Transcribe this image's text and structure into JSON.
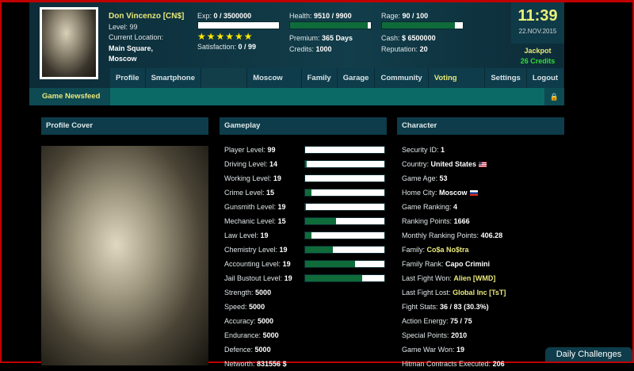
{
  "player": {
    "name": "Don Vincenzo [CN$]",
    "level_label": "Level:",
    "level": "99",
    "location_label": "Current Location:",
    "location1": "Main Square,",
    "location2": "Moscow"
  },
  "stats": {
    "exp_label": "Exp:",
    "exp": "0 / 3500000",
    "exp_fill": 0,
    "stars": "★★★★★★",
    "satisfaction_label": "Satisfaction:",
    "satisfaction": "0 / 99",
    "health_label": "Health:",
    "health": "9510 / 9900",
    "health_fill": 0.96,
    "premium_label": "Premium:",
    "premium": "365 Days",
    "credits_label": "Credits:",
    "credits": "1000",
    "rage_label": "Rage:",
    "rage": "90 / 100",
    "rage_fill": 0.9,
    "cash_label": "Cash:",
    "cash": "$ 6500000",
    "reputation_label": "Reputation:",
    "reputation": "20"
  },
  "clock": {
    "time": "11:39",
    "date": "22.NOV.2015",
    "jackpot_label": "Jackpot",
    "jackpot_value": "26 Credits"
  },
  "nav": [
    "Profile",
    "Smartphone",
    "",
    "Moscow City",
    "Family",
    "Garage",
    "Community",
    "Voting Center",
    "Settings",
    "Logout"
  ],
  "newsfeed": {
    "label": "Game Newsfeed",
    "lock_icon": "lock-icon"
  },
  "panels": {
    "cover": "Profile Cover",
    "gameplay": "Gameplay",
    "character": "Character"
  },
  "gameplay": {
    "levels": [
      {
        "label": "Player Level:",
        "value": "99",
        "fill": 0
      },
      {
        "label": "Driving Level:",
        "value": "14",
        "fill": 0.02
      },
      {
        "label": "Working Level:",
        "value": "19",
        "fill": 0
      },
      {
        "label": "Crime Level:",
        "value": "15",
        "fill": 0.08
      },
      {
        "label": "Gunsmith Level:",
        "value": "19",
        "fill": 0.01
      },
      {
        "label": "Mechanic Level:",
        "value": "15",
        "fill": 0.39
      },
      {
        "label": "Law Level:",
        "value": "19",
        "fill": 0.08
      },
      {
        "label": "Chemistry Level:",
        "value": "19",
        "fill": 0.35
      },
      {
        "label": "Accounting Level:",
        "value": "19",
        "fill": 0.63
      },
      {
        "label": "Jail Bustout Level:",
        "value": "19",
        "fill": 0.72
      }
    ],
    "attrs": [
      {
        "label": "Strength:",
        "value": "5000"
      },
      {
        "label": "Speed:",
        "value": "5000"
      },
      {
        "label": "Accuracy:",
        "value": "5000"
      },
      {
        "label": "Endurance:",
        "value": "5000"
      },
      {
        "label": "Defence:",
        "value": "5000"
      },
      {
        "label": "Networth:",
        "value": "831556 $"
      }
    ]
  },
  "character": [
    {
      "label": "Security ID:",
      "value": "1"
    },
    {
      "label": "Country:",
      "value": "United States",
      "flag": "us"
    },
    {
      "label": "Game Age:",
      "value": "53"
    },
    {
      "label": "Home City:",
      "value": "Moscow",
      "flag": "ru"
    },
    {
      "label": "Game Ranking:",
      "value": "4"
    },
    {
      "label": "Ranking Points:",
      "value": "1666"
    },
    {
      "label": "Monthly Ranking Points:",
      "value": "406.28"
    },
    {
      "label": "Family:",
      "value": "Co$a No$tra",
      "highlight": true
    },
    {
      "label": "Family Rank:",
      "value": "Capo Crimini"
    },
    {
      "label": "Last Fight Won:",
      "value": "Alien [WMD]",
      "highlight": true
    },
    {
      "label": "Last Fight Lost:",
      "value": "Global Inc [TsT]",
      "highlight": true
    },
    {
      "label": "Fight Stats:",
      "value": "36 / 83 (30.3%)"
    },
    {
      "label": "Action Energy:",
      "value": "75 / 75"
    },
    {
      "label": "Special Points:",
      "value": "2010"
    },
    {
      "label": "Game War Won:",
      "value": "19"
    },
    {
      "label": "Hitman Contracts Executed:",
      "value": "206"
    }
  ],
  "daily": "Daily Challenges",
  "colors": {
    "accent_yellow": "#e8e87a",
    "bar_green": "#0f6b3a",
    "panel_header": "#0e3c4a",
    "jackpot_green": "#33dd33"
  }
}
